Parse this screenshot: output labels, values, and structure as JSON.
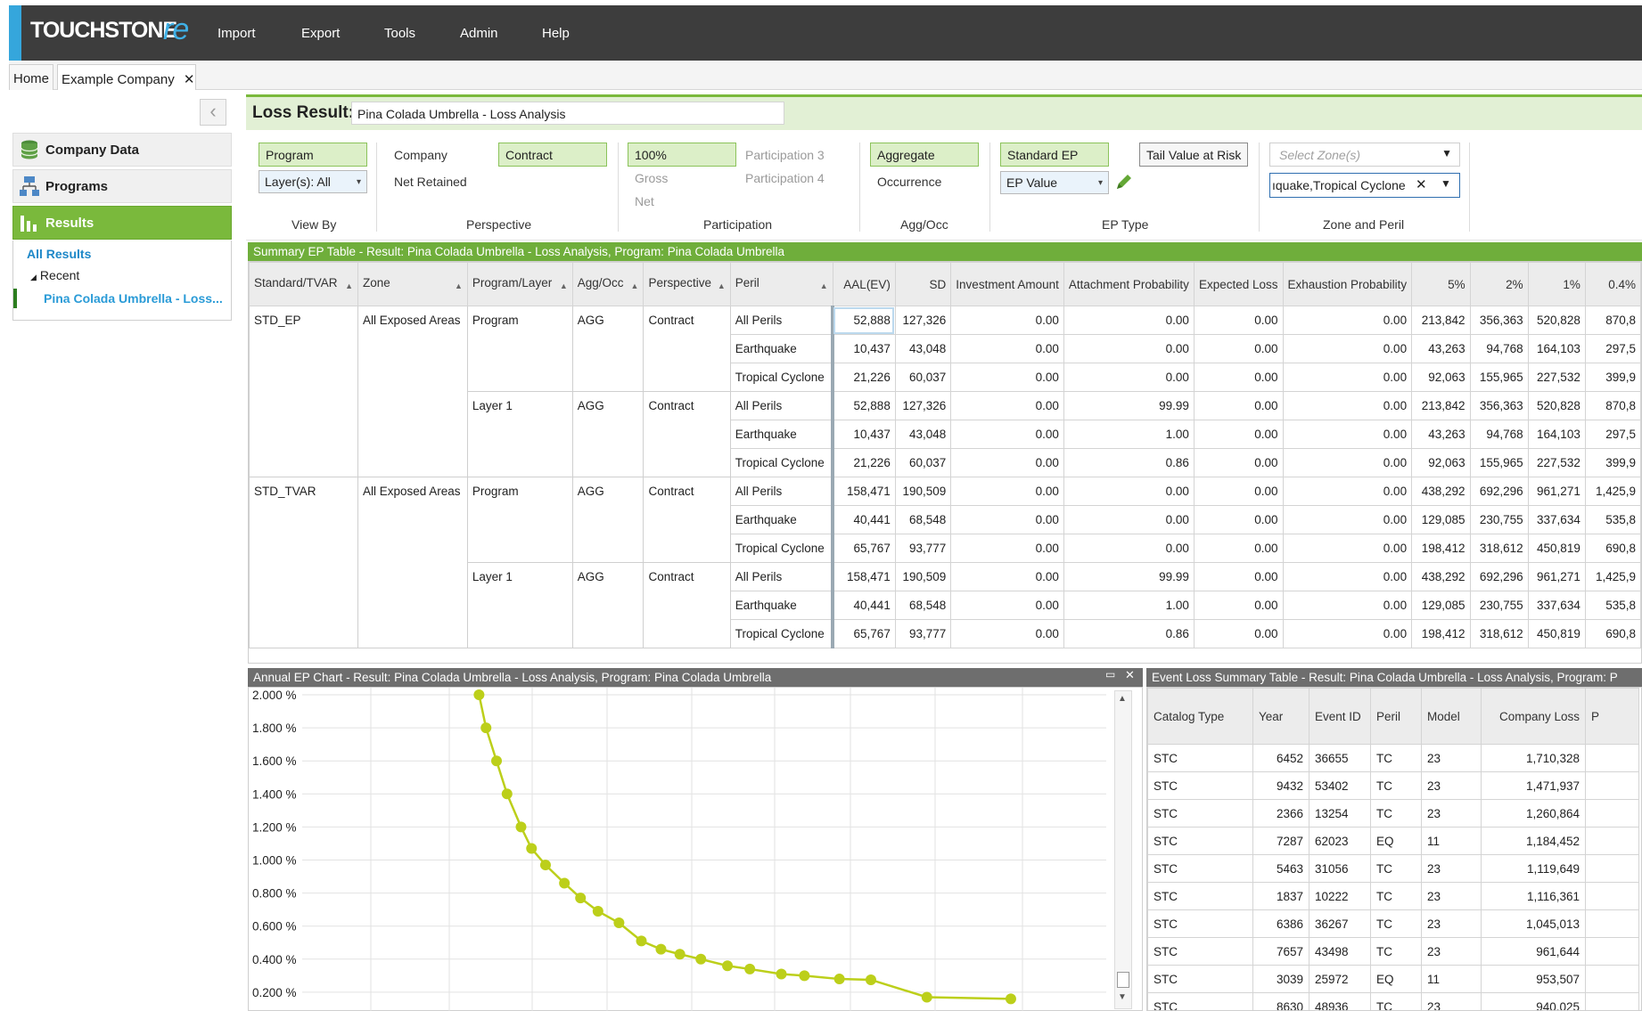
{
  "app": {
    "logo_main": "TOUCHSTONE",
    "logo_suffix": "re",
    "menu": [
      "Import",
      "Export",
      "Tools",
      "Admin",
      "Help"
    ]
  },
  "tabs": {
    "home": "Home",
    "company": "Example Company",
    "close_glyph": "✕"
  },
  "sidebar": {
    "collapse_glyph": "‹",
    "items": [
      {
        "label": "Company Data",
        "icon": "database-icon"
      },
      {
        "label": "Programs",
        "icon": "hierarchy-icon"
      },
      {
        "label": "Results",
        "icon": "bar-chart-icon"
      }
    ],
    "tree": {
      "all_results": "All Results",
      "recent": "Recent",
      "recent_toggle": "◢",
      "item": "Pina Colada Umbrella - Loss..."
    }
  },
  "loss_result": {
    "label": "Loss Result:",
    "value": "Pina Colada Umbrella - Loss Analysis"
  },
  "filters": {
    "view_by": {
      "program": "Program",
      "layers": "Layer(s): All",
      "group": "View By"
    },
    "perspective": {
      "company": "Company",
      "net_retained": "Net Retained",
      "contract": "Contract",
      "group": "Perspective"
    },
    "participation": {
      "pct": "100%",
      "gross": "Gross",
      "net": "Net",
      "p3": "Participation 3",
      "p4": "Participation 4",
      "group": "Participation"
    },
    "agg_occ": {
      "aggregate": "Aggregate",
      "occurrence": "Occurrence",
      "group": "Agg/Occ"
    },
    "ep_type": {
      "standard_ep": "Standard EP",
      "tvar": "Tail Value at Risk",
      "ep_value": "EP Value",
      "group": "EP Type"
    },
    "zone_peril": {
      "zone_placeholder": "Select Zone(s)",
      "peril_value": "ıquake,Tropical Cyclone",
      "group": "Zone and Peril"
    }
  },
  "ep_table": {
    "title": "Summary EP Table - Result: Pina Colada Umbrella - Loss Analysis, Program: Pina Colada Umbrella",
    "columns": [
      "Standard/TVAR",
      "Zone",
      "Program/Layer",
      "Agg/Occ",
      "Perspective",
      "Peril",
      "AAL(EV)",
      "SD",
      "Investment Amount",
      "Attachment Probability",
      "Expected Loss",
      "Exhaustion Probability",
      "5%",
      "2%",
      "1%",
      "0.4%"
    ],
    "groups": [
      {
        "std": "STD_EP",
        "zone": "All Exposed Areas",
        "prog": "Program",
        "agg": "AGG",
        "persp": "Contract",
        "rows": [
          [
            "All Perils",
            "52,888",
            "127,326",
            "0.00",
            "0.00",
            "0.00",
            "0.00",
            "213,842",
            "356,363",
            "520,828",
            "870,8"
          ],
          [
            "Earthquake",
            "10,437",
            "43,048",
            "0.00",
            "0.00",
            "0.00",
            "0.00",
            "43,263",
            "94,768",
            "164,103",
            "297,5"
          ],
          [
            "Tropical Cyclone",
            "21,226",
            "60,037",
            "0.00",
            "0.00",
            "0.00",
            "0.00",
            "92,063",
            "155,965",
            "227,532",
            "399,9"
          ]
        ]
      },
      {
        "std": "",
        "zone": "",
        "prog": "Layer  1",
        "agg": "AGG",
        "persp": "Contract",
        "rows": [
          [
            "All Perils",
            "52,888",
            "127,326",
            "0.00",
            "99.99",
            "0.00",
            "0.00",
            "213,842",
            "356,363",
            "520,828",
            "870,8"
          ],
          [
            "Earthquake",
            "10,437",
            "43,048",
            "0.00",
            "1.00",
            "0.00",
            "0.00",
            "43,263",
            "94,768",
            "164,103",
            "297,5"
          ],
          [
            "Tropical Cyclone",
            "21,226",
            "60,037",
            "0.00",
            "0.86",
            "0.00",
            "0.00",
            "92,063",
            "155,965",
            "227,532",
            "399,9"
          ]
        ]
      },
      {
        "std": "STD_TVAR",
        "zone": "All Exposed Areas",
        "prog": "Program",
        "agg": "AGG",
        "persp": "Contract",
        "rows": [
          [
            "All Perils",
            "158,471",
            "190,509",
            "0.00",
            "0.00",
            "0.00",
            "0.00",
            "438,292",
            "692,296",
            "961,271",
            "1,425,9"
          ],
          [
            "Earthquake",
            "40,441",
            "68,548",
            "0.00",
            "0.00",
            "0.00",
            "0.00",
            "129,085",
            "230,755",
            "337,634",
            "535,8"
          ],
          [
            "Tropical Cyclone",
            "65,767",
            "93,777",
            "0.00",
            "0.00",
            "0.00",
            "0.00",
            "198,412",
            "318,612",
            "450,819",
            "690,8"
          ]
        ]
      },
      {
        "std": "",
        "zone": "",
        "prog": "Layer  1",
        "agg": "AGG",
        "persp": "Contract",
        "rows": [
          [
            "All Perils",
            "158,471",
            "190,509",
            "0.00",
            "99.99",
            "0.00",
            "0.00",
            "438,292",
            "692,296",
            "961,271",
            "1,425,9"
          ],
          [
            "Earthquake",
            "40,441",
            "68,548",
            "0.00",
            "1.00",
            "0.00",
            "0.00",
            "129,085",
            "230,755",
            "337,634",
            "535,8"
          ],
          [
            "Tropical Cyclone",
            "65,767",
            "93,777",
            "0.00",
            "0.86",
            "0.00",
            "0.00",
            "198,412",
            "318,612",
            "450,819",
            "690,8"
          ]
        ]
      }
    ]
  },
  "ep_chart": {
    "title": "Annual EP Chart - Result: Pina Colada Umbrella - Loss Analysis, Program: Pina Colada Umbrella",
    "controls": {
      "minimize": "▭",
      "close": "✕",
      "scroll_up": "▲",
      "scroll_down": "▼"
    }
  },
  "chart_data": {
    "type": "line",
    "title": "Annual EP Chart - Result: Pina Colada Umbrella - Loss Analysis, Program: Pina Colada Umbrella",
    "yticks": [
      "2.000 %",
      "1.800 %",
      "1.600 %",
      "1.400 %",
      "1.200 %",
      "1.000 %",
      "0.800 %",
      "0.600 %",
      "0.400 %",
      "0.200 %"
    ],
    "ylim": [
      0.1,
      2.0
    ],
    "xlim": [
      0,
      1000
    ],
    "grid": true,
    "line_color": "#bccf1a",
    "series": [
      {
        "points": [
          [
            240,
            2.0
          ],
          [
            250,
            1.8
          ],
          [
            265,
            1.6
          ],
          [
            280,
            1.4
          ],
          [
            300,
            1.2
          ],
          [
            315,
            1.07
          ],
          [
            335,
            0.97
          ],
          [
            362,
            0.86
          ],
          [
            385,
            0.77
          ],
          [
            410,
            0.69
          ],
          [
            440,
            0.62
          ],
          [
            472,
            0.51
          ],
          [
            500,
            0.46
          ],
          [
            527,
            0.43
          ],
          [
            557,
            0.4
          ],
          [
            595,
            0.36
          ],
          [
            627,
            0.34
          ],
          [
            672,
            0.31
          ],
          [
            705,
            0.3
          ],
          [
            755,
            0.28
          ],
          [
            800,
            0.275
          ],
          [
            880,
            0.17
          ],
          [
            1000,
            0.16
          ]
        ]
      }
    ]
  },
  "event_table": {
    "title": "Event Loss Summary Table - Result: Pina Colada Umbrella - Loss Analysis, Program: P",
    "columns": [
      "Catalog Type",
      "Year",
      "Event ID",
      "Peril",
      "Model",
      "Company Loss",
      "P"
    ],
    "rows": [
      [
        "STC",
        "6452",
        "36655",
        "TC",
        "23",
        "1,710,328"
      ],
      [
        "STC",
        "9432",
        "53402",
        "TC",
        "23",
        "1,471,937"
      ],
      [
        "STC",
        "2366",
        "13254",
        "TC",
        "23",
        "1,260,864"
      ],
      [
        "STC",
        "7287",
        "62023",
        "EQ",
        "11",
        "1,184,452"
      ],
      [
        "STC",
        "5463",
        "31056",
        "TC",
        "23",
        "1,119,649"
      ],
      [
        "STC",
        "1837",
        "10222",
        "TC",
        "23",
        "1,116,361"
      ],
      [
        "STC",
        "6386",
        "36267",
        "TC",
        "23",
        "1,045,013"
      ],
      [
        "STC",
        "7657",
        "43498",
        "TC",
        "23",
        "961,644"
      ],
      [
        "STC",
        "3039",
        "25972",
        "EQ",
        "11",
        "953,507"
      ],
      [
        "STC",
        "8630",
        "48936",
        "TC",
        "23",
        "940,025"
      ]
    ]
  },
  "colors": {
    "accent_green": "#7ab93c",
    "header_dark": "#3d3d3d",
    "logo_blue": "#3fb0e6"
  }
}
